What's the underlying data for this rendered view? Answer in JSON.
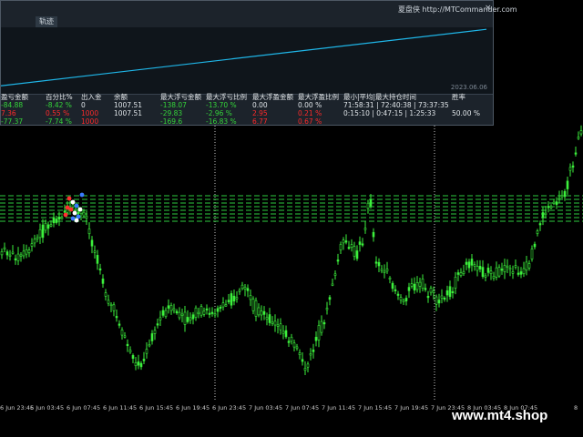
{
  "panel": {
    "title": "夏盘侠 http://MTCommander.com",
    "close_symbol": "×",
    "tabs": [
      "",
      "轨迹"
    ],
    "date": "2023.06.06",
    "equity_curve": {
      "start": 0.12,
      "end": 0.97
    }
  },
  "stats": {
    "headers": [
      "盈亏金额",
      "百分比%",
      "出入金",
      "余额",
      "最大浮亏金额",
      "最大浮亏比例",
      "最大浮盈金额",
      "最大浮盈比例",
      "最小|平均|最大持仓时间",
      "胜率"
    ],
    "rows": [
      [
        "-84.88",
        "-8.42 %",
        "0",
        "1007.51",
        "-138.07",
        "-13.70 %",
        "0.00",
        "0.00 %",
        "71:58:31 | 72:40:38 | 73:37:35",
        "50.00 %"
      ],
      [
        "7.36",
        "0.55 %",
        "1000",
        "1007.51",
        "-29.83",
        "-2.96 %",
        "2.95",
        "0.21 %",
        "0:15:10 | 0:47:15 | 1:25:33",
        ""
      ],
      [
        "-77.37",
        "-7.74 %",
        "1000",
        "",
        "-169.6",
        "-16.83 %",
        "6.77",
        "0.67 %",
        "",
        ""
      ]
    ]
  },
  "time_axis": {
    "labels": [
      "6 Jun 23:45",
      "6 Jun 03:45",
      "6 Jun 07:45",
      "6 Jun 11:45",
      "6 Jun 15:45",
      "6 Jun 19:45",
      "6 Jun 23:45",
      "7 Jun 03:45",
      "7 Jun 07:45",
      "7 Jun 11:45",
      "7 Jun 15:45",
      "7 Jun 19:45",
      "7 Jun 23:45",
      "8 Jun 03:45",
      "8 Jun 07:45",
      "8"
    ]
  },
  "watermark": "www.mt4.shop",
  "colors": {
    "bull": "#3cf03c",
    "bear": "#3cf03c",
    "curve": "#1fb6e8",
    "level": "#2ecc40"
  }
}
